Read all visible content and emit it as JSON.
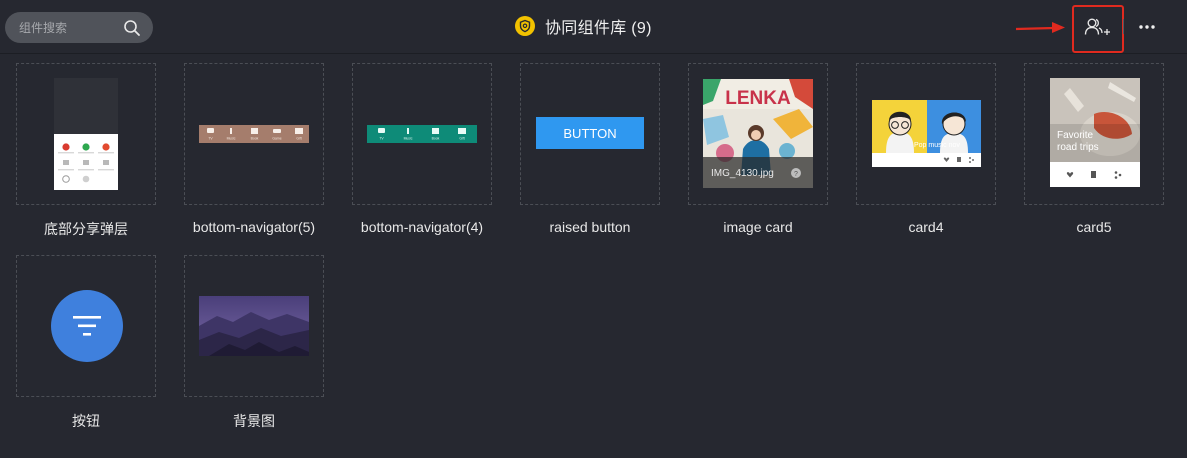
{
  "header": {
    "search": {
      "placeholder": "组件搜索",
      "icon": "search-icon"
    },
    "title": "协同组件库 (9)",
    "title_icon": "shield-badge-icon",
    "actions": [
      {
        "name": "invite-collaborator",
        "icon": "user-add-icon"
      },
      {
        "name": "more",
        "icon": "more-dots-icon"
      }
    ],
    "highlight_color": "#e02a1f",
    "accent_color": "#f2c200"
  },
  "components": [
    {
      "label": "底部分享弹层"
    },
    {
      "label": "bottom-navigator(5)",
      "tabs": [
        "TV",
        "Music",
        "Book",
        "Game",
        "Gift"
      ]
    },
    {
      "label": "bottom-navigator(4)",
      "tabs": [
        "TV",
        "Music",
        "Book",
        "Gift"
      ]
    },
    {
      "label": "raised button",
      "button_text": "BUTTON"
    },
    {
      "label": "image card",
      "title_text": "LENKA",
      "caption": "IMG_4130.jpg"
    },
    {
      "label": "card4",
      "caption": "Pop music nov"
    },
    {
      "label": "card5",
      "caption_line1": "Favorite",
      "caption_line2": "road trips"
    },
    {
      "label": "按钮"
    },
    {
      "label": "背景图"
    }
  ]
}
